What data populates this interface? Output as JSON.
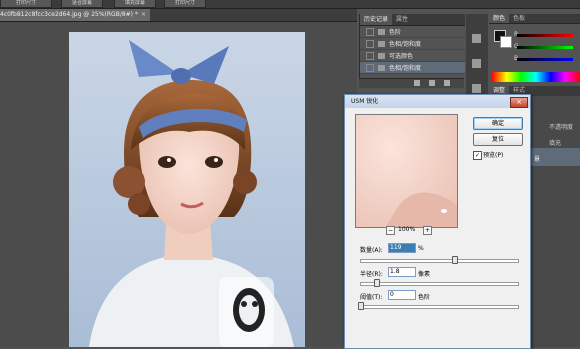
{
  "topbar": {
    "buttons": [
      "打印尺寸",
      "适合屏幕",
      "填充屏幕",
      "打印尺寸"
    ]
  },
  "document_tab": {
    "title": "4c0fb812c8fcc3ce2d64.jpg @ 25%(RGB/8#) *",
    "close": "×"
  },
  "history_panel": {
    "tabs": [
      "历史记录",
      "属性"
    ],
    "items": [
      "色阶",
      "色相/饱和度",
      "可选颜色",
      "色相/饱和度"
    ],
    "selected_index": 3
  },
  "color_panel": {
    "tabs": [
      "颜色",
      "色板"
    ],
    "channels": [
      "R",
      "G",
      "B"
    ]
  },
  "adjust_tabs": [
    "调整",
    "样式"
  ],
  "layers_panel": {
    "label1": "不透明度",
    "label2": "填充",
    "item": "景"
  },
  "dialog": {
    "title": "USM 锐化",
    "close": "×",
    "ok": "确定",
    "reset": "复位",
    "preview_label": "预览(P)",
    "preview_checked": true,
    "zoom": "100%",
    "zoom_minus": "−",
    "zoom_plus": "+",
    "amount_label": "数量(A):",
    "amount_value": "119",
    "amount_unit": "%",
    "radius_label": "半径(R):",
    "radius_value": "1.8",
    "radius_unit": "像素",
    "threshold_label": "阈值(T):",
    "threshold_value": "0",
    "threshold_unit": "色阶"
  },
  "colors": {
    "dialog_accent": "#3c7fb1",
    "panel_bg": "#535353",
    "selected_row": "#5f6b78"
  }
}
